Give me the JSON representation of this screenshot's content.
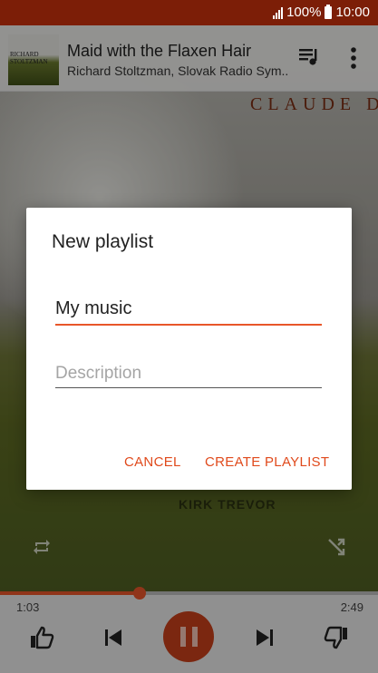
{
  "status_bar": {
    "battery": "100%",
    "time": "10:00"
  },
  "now_playing": {
    "title": "Maid with the Flaxen Hair",
    "artist": "Richard Stoltzman, Slovak Radio Sym..",
    "thumb_text": "RICHARD STOLTZMAN"
  },
  "album_art": {
    "heading": "CLAUDE D",
    "sub": "KIRK TREVOR"
  },
  "dialog": {
    "title": "New playlist",
    "name_value": "My music",
    "description_placeholder": "Description",
    "cancel_label": "CANCEL",
    "create_label": "CREATE PLAYLIST"
  },
  "playback": {
    "elapsed": "1:03",
    "total": "2:49",
    "progress": 0.37
  },
  "colors": {
    "accent": "#e8562a",
    "status_bar": "#7c1e07",
    "play_button": "#c7401b"
  },
  "icons": [
    "signal-icon",
    "battery-icon",
    "queue-icon",
    "more-vert-icon",
    "repeat-icon",
    "shuffle-icon",
    "thumbs-up-icon",
    "skip-previous-icon",
    "pause-icon",
    "skip-next-icon",
    "thumbs-down-icon"
  ]
}
